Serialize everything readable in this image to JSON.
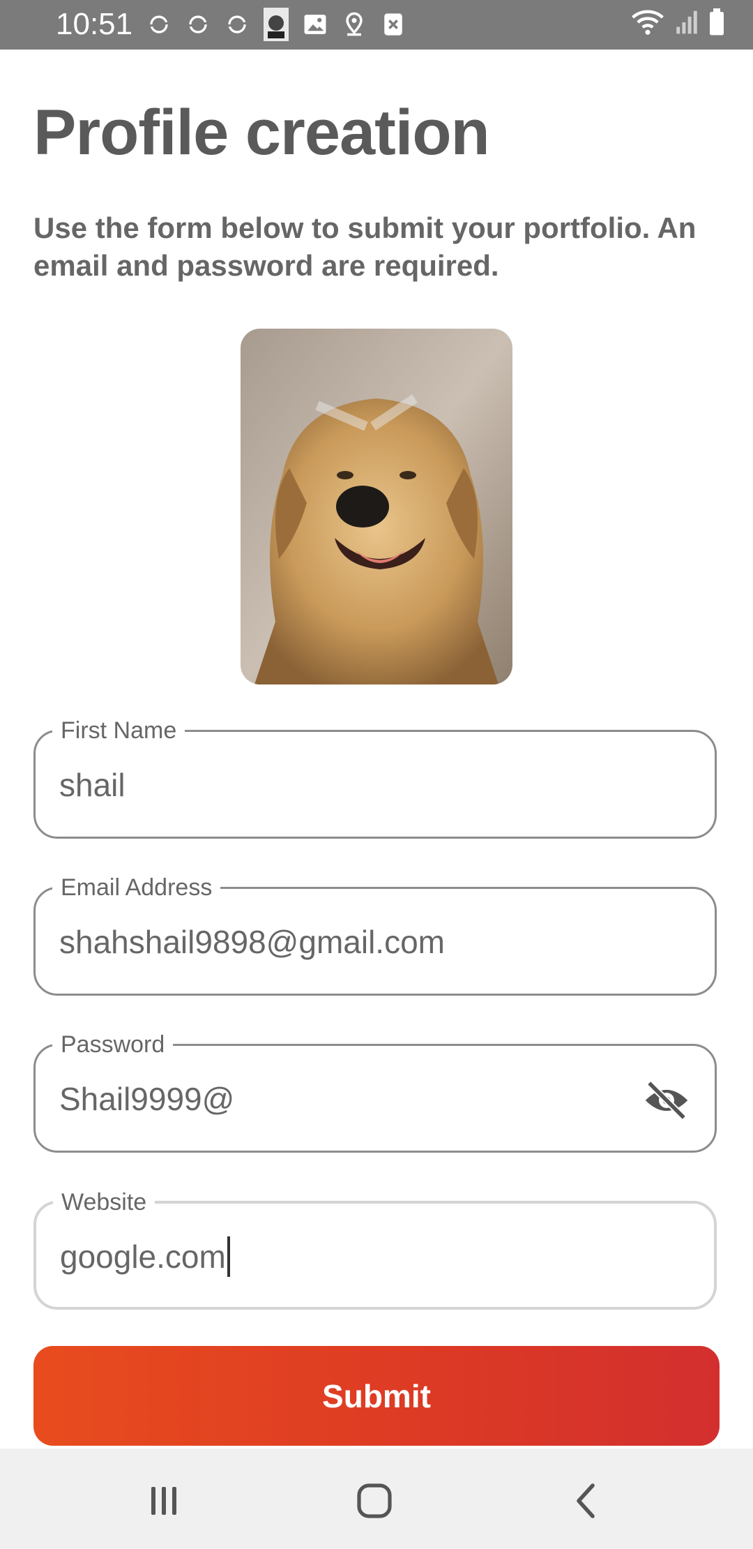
{
  "status_bar": {
    "time": "10:51",
    "left_icons": [
      "sync-icon",
      "sync-icon",
      "sync-icon",
      "app-thumbnail-icon",
      "image-icon",
      "location-icon",
      "close-box-icon"
    ],
    "right_icons": [
      "wifi-icon",
      "signal-icon",
      "battery-icon"
    ]
  },
  "header": {
    "title": "Profile creation",
    "subtitle": "Use the form below to submit your portfolio. An email and password are required."
  },
  "form": {
    "first_name": {
      "label": "First Name",
      "value": "shail"
    },
    "email": {
      "label": "Email Address",
      "value": "shahshail9898@gmail.com"
    },
    "password": {
      "label": "Password",
      "value": "Shail9999@",
      "toggle_icon": "eye-off-icon"
    },
    "website": {
      "label": "Website",
      "value": "google.com"
    },
    "submit_label": "Submit"
  },
  "nav_bar": {
    "items": [
      "recent-apps-icon",
      "home-icon",
      "back-icon"
    ]
  },
  "colors": {
    "status_bar_bg": "#7b7b7b",
    "submit_gradient_start": "#e84c1e",
    "submit_gradient_end": "#d32f2f",
    "nav_bar_bg": "#f0f0f0"
  }
}
